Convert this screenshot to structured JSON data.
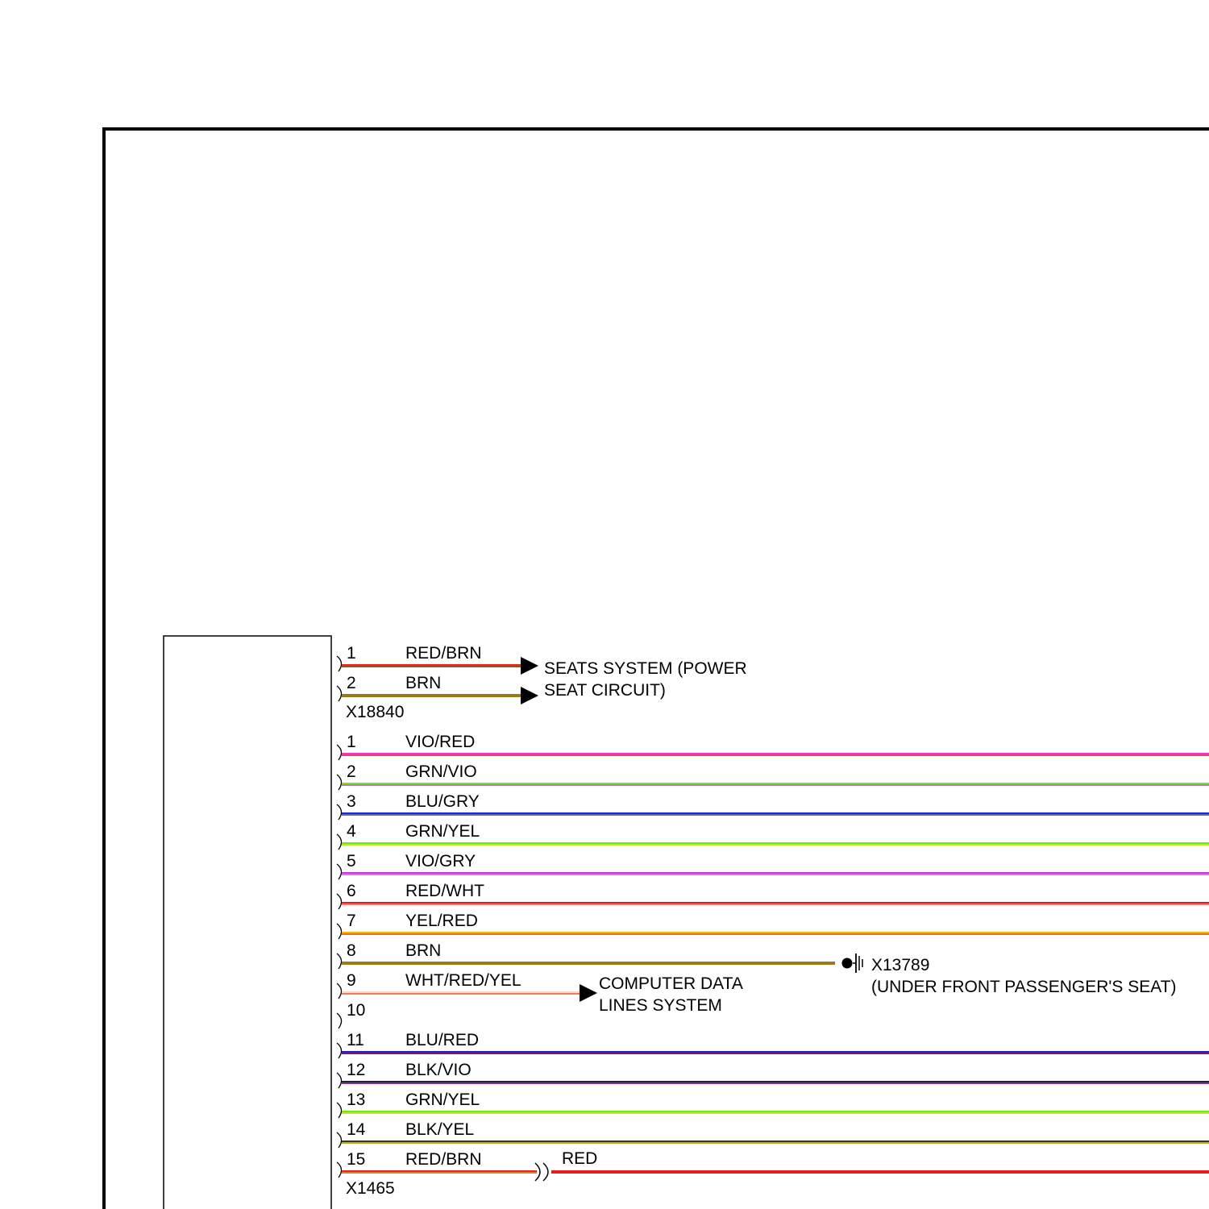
{
  "connector_a": {
    "name": "X18840",
    "destination": [
      "SEATS SYSTEM (POWER",
      "SEAT CIRCUIT)"
    ],
    "wires": [
      {
        "pin": "1",
        "label": "RED/BRN",
        "colors": [
          "#e8261a",
          "#8b5a1a"
        ]
      },
      {
        "pin": "2",
        "label": "BRN",
        "colors": [
          "#a07818"
        ]
      }
    ]
  },
  "connector_b": {
    "name": "X1465",
    "wires": [
      {
        "pin": "1",
        "label": "VIO/RED",
        "colors": [
          "#ee3ac0",
          "#ff2a6a"
        ]
      },
      {
        "pin": "2",
        "label": "GRN/VIO",
        "colors": [
          "#7ee02a",
          "#c05ae8"
        ]
      },
      {
        "pin": "3",
        "label": "BLU/GRY",
        "colors": [
          "#1a2adc",
          "#7a7a9a"
        ]
      },
      {
        "pin": "4",
        "label": "GRN/YEL",
        "colors": [
          "#6ee81a",
          "#d8e81a"
        ]
      },
      {
        "pin": "5",
        "label": "VIO/GRY",
        "colors": [
          "#c83ae0",
          "#e888e8"
        ]
      },
      {
        "pin": "6",
        "label": "RED/WHT",
        "colors": [
          "#e81a1a",
          "#ff9a9a"
        ]
      },
      {
        "pin": "7",
        "label": "YEL/RED",
        "colors": [
          "#f0b800",
          "#e85a1a"
        ]
      },
      {
        "pin": "8",
        "label": "BRN",
        "colors": [
          "#a07818"
        ]
      },
      {
        "pin": "9",
        "label": "WHT/RED/YEL",
        "colors": [
          "#ffd8c0",
          "#e85a3a"
        ]
      },
      {
        "pin": "10",
        "label": "",
        "colors": []
      },
      {
        "pin": "11",
        "label": "BLU/RED",
        "colors": [
          "#2a1ac8",
          "#8a1a6a"
        ]
      },
      {
        "pin": "12",
        "label": "BLK/VIO",
        "colors": [
          "#2a1a3a",
          "#a83ad0"
        ]
      },
      {
        "pin": "13",
        "label": "GRN/YEL",
        "colors": [
          "#6ee81a",
          "#d8e81a"
        ]
      },
      {
        "pin": "14",
        "label": "BLK/YEL",
        "colors": [
          "#3a3a10",
          "#d8d81a"
        ]
      },
      {
        "pin": "15",
        "label": "RED/BRN",
        "colors": [
          "#e8261a",
          "#d89a3a"
        ]
      }
    ],
    "splice_wire_label": "RED",
    "splice_wire_color": "#e81a1a"
  },
  "ground": {
    "name": "X13789",
    "location": "(UNDER FRONT PASSENGER'S SEAT)"
  },
  "computer_data": [
    "COMPUTER DATA",
    "LINES SYSTEM"
  ]
}
